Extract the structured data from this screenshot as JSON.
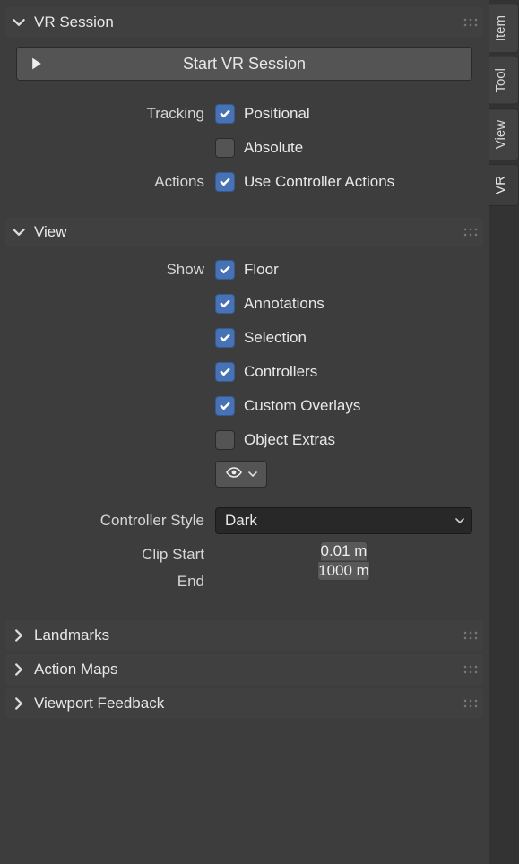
{
  "sidebar_tabs": [
    {
      "label": "Item",
      "active": false
    },
    {
      "label": "Tool",
      "active": false
    },
    {
      "label": "View",
      "active": false
    },
    {
      "label": "VR",
      "active": true
    }
  ],
  "panels": {
    "vr_session": {
      "title": "VR Session",
      "expanded": true,
      "start_button": "Start VR Session",
      "rows": [
        {
          "label": "Tracking",
          "control": "checkbox",
          "checked": true,
          "text": "Positional"
        },
        {
          "label": "",
          "control": "checkbox",
          "checked": false,
          "text": "Absolute"
        },
        {
          "label": "Actions",
          "control": "checkbox",
          "checked": true,
          "text": "Use Controller Actions"
        }
      ]
    },
    "view": {
      "title": "View",
      "expanded": true,
      "show_rows": [
        {
          "label": "Show",
          "checked": true,
          "text": "Floor"
        },
        {
          "label": "",
          "checked": true,
          "text": "Annotations"
        },
        {
          "label": "",
          "checked": true,
          "text": "Selection"
        },
        {
          "label": "",
          "checked": true,
          "text": "Controllers"
        },
        {
          "label": "",
          "checked": true,
          "text": "Custom Overlays"
        },
        {
          "label": "",
          "checked": false,
          "text": "Object Extras"
        }
      ],
      "controller_style": {
        "label": "Controller Style",
        "value": "Dark"
      },
      "clip_start": {
        "label": "Clip Start",
        "value": "0.01 m"
      },
      "clip_end": {
        "label": "End",
        "value": "1000 m"
      }
    },
    "landmarks": {
      "title": "Landmarks",
      "expanded": false
    },
    "action_maps": {
      "title": "Action Maps",
      "expanded": false
    },
    "viewport_feedback": {
      "title": "Viewport Feedback",
      "expanded": false
    }
  }
}
